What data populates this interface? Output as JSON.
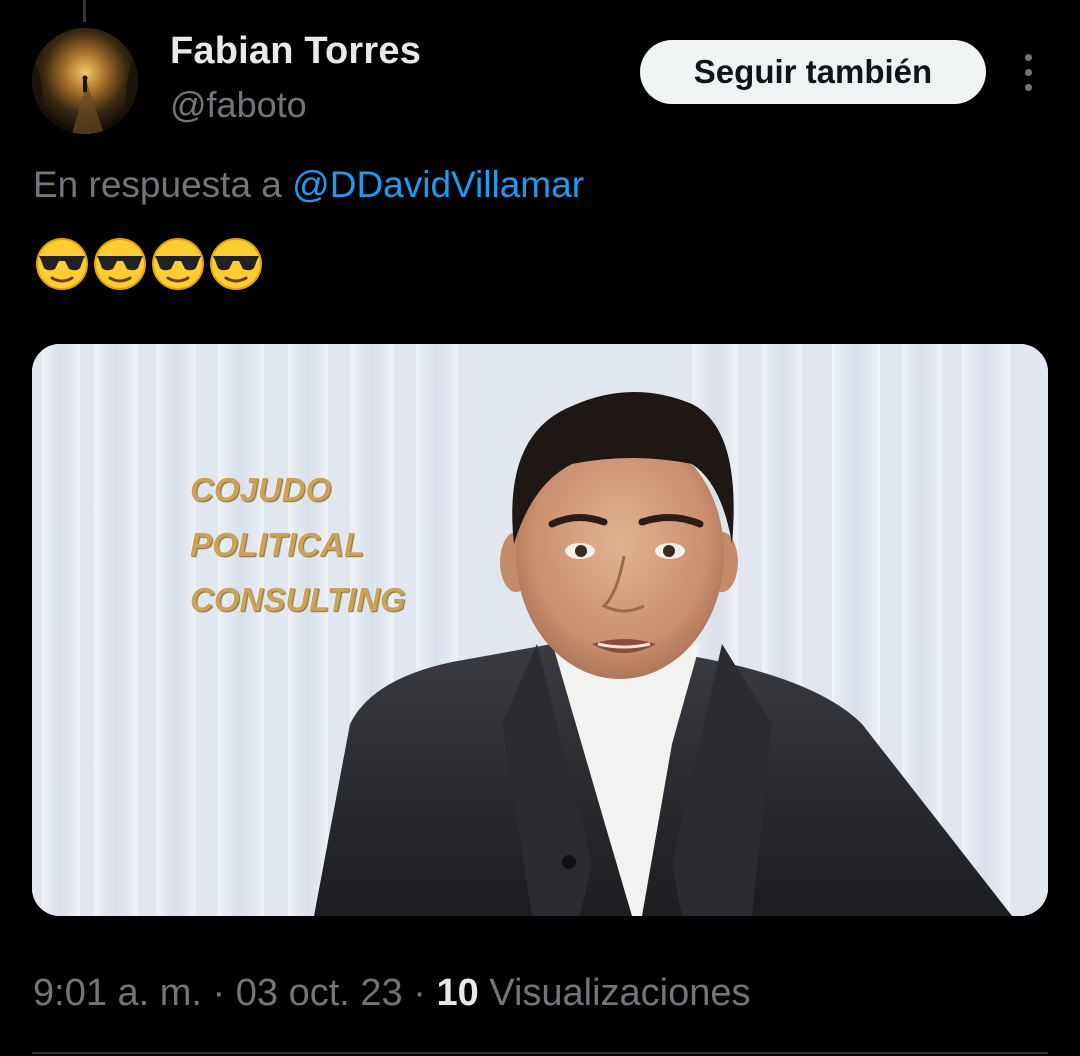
{
  "author": {
    "display_name": "Fabian Torres",
    "handle": "@faboto",
    "avatar_icon": "avatar-photo"
  },
  "actions": {
    "follow_label": "Seguir también",
    "more_icon": "more-vertical-icon"
  },
  "reply": {
    "prefix": "En respuesta a",
    "mention": "@DDavidVillamar"
  },
  "body": {
    "emojis": [
      "😎",
      "😎",
      "😎",
      "😎"
    ]
  },
  "media": {
    "overlay_lines": [
      "COJUDO",
      "POLITICAL",
      "CONSULTING"
    ]
  },
  "meta": {
    "time": "9:01 a. m.",
    "separator": "·",
    "date": "03 oct. 23",
    "views_count": "10",
    "views_label": "Visualizaciones"
  },
  "colors": {
    "background": "#000000",
    "text": "#e7e9ea",
    "muted": "#71767b",
    "link": "#1d9bf0",
    "button_bg": "#eff3f4"
  }
}
